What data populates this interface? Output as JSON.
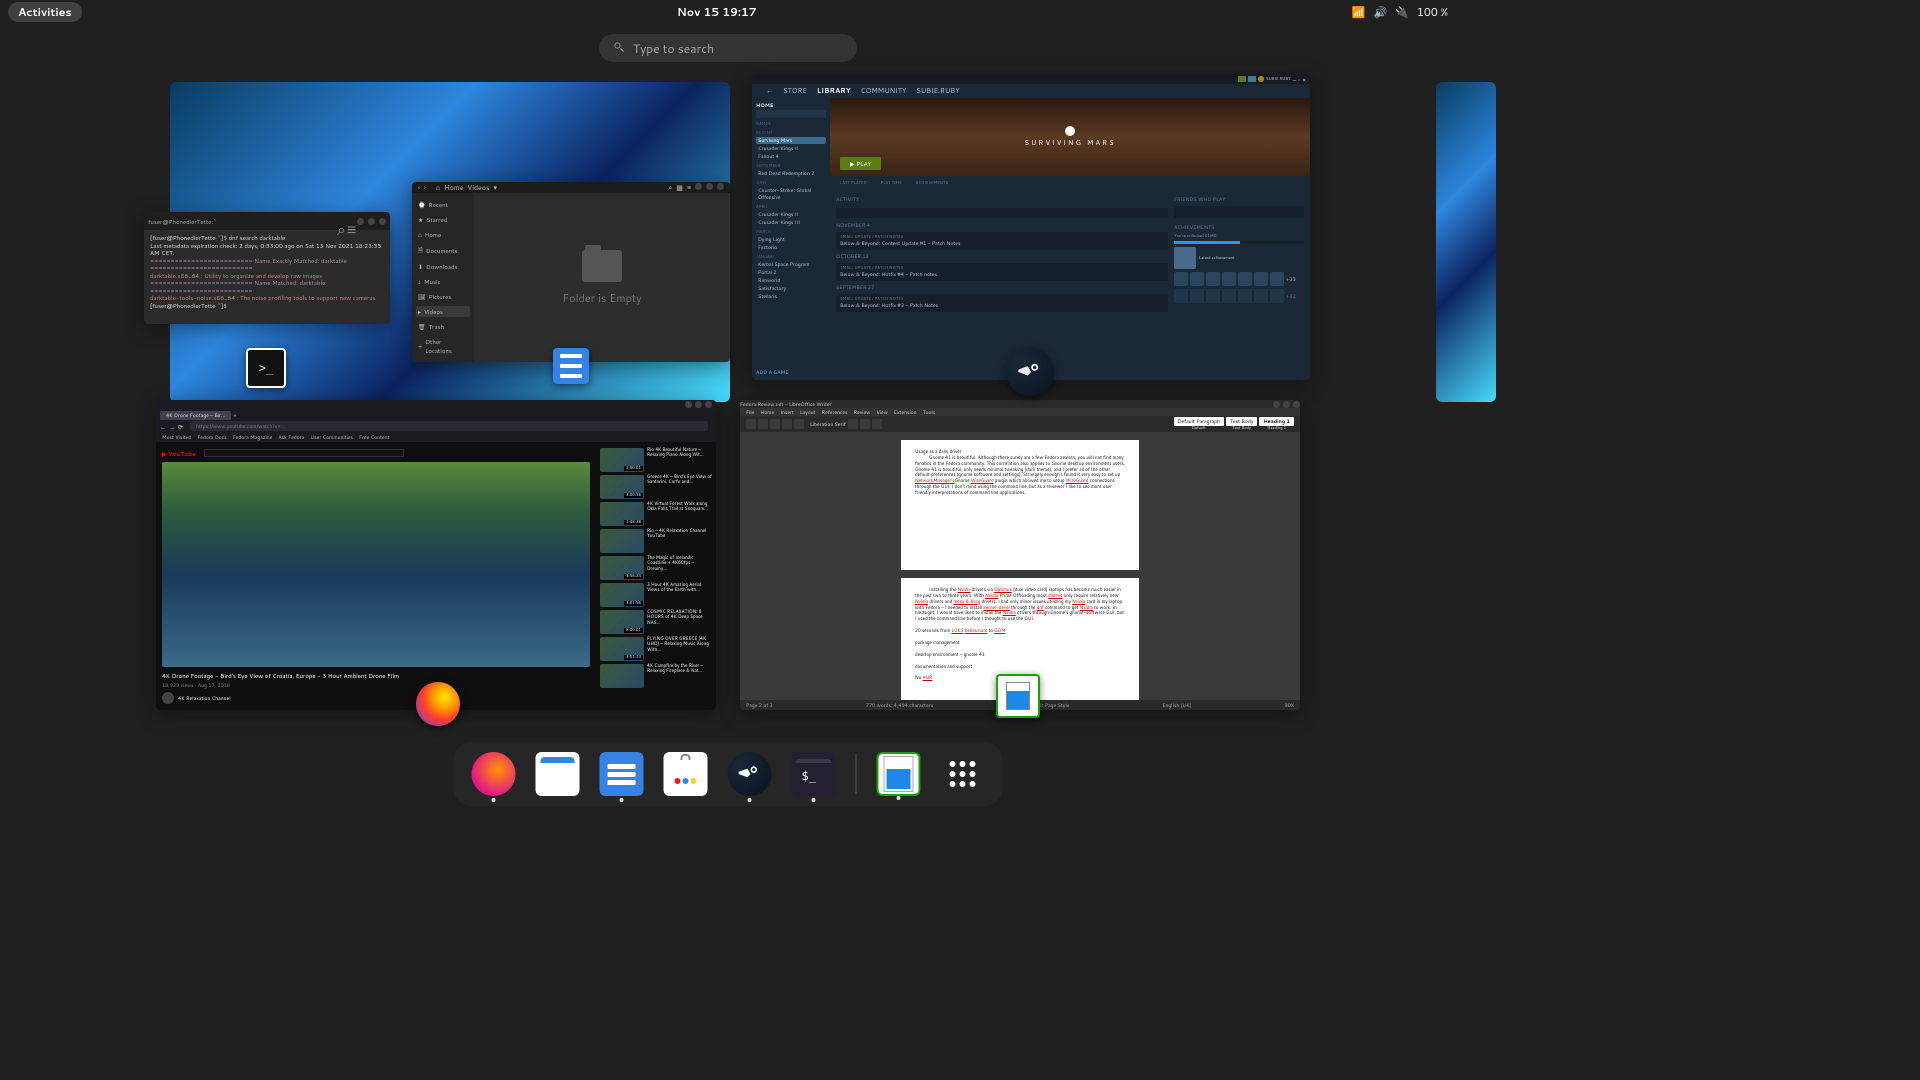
{
  "topbar": {
    "activities": "Activities",
    "clock": "Nov 15  19:17",
    "battery": "100 %"
  },
  "search": {
    "placeholder": "Type to search"
  },
  "terminal": {
    "user_host": "fuser@PhonedierTette:~",
    "lines": [
      "[fuser@PhonedierTette ~]$ dnf search darktable",
      "Last metadata expiration check: 2 days, 0:53:00 ago on Sat 13 Nov 2021 18:23:55 AM CET.",
      "========================= Name Exactly Matched: darktable =========================",
      "darktable.x86_64 : Utility to organize and develop raw images",
      "========================= Name Matched: darktable =========================",
      "darktable-tools-noise.x86_64 : The noise profiling tools to support new cameras",
      "[fuser@PhonedierTette ~]$ "
    ]
  },
  "nautilus": {
    "path": [
      "Home",
      "Videos"
    ],
    "sidebar": [
      "Recent",
      "Starred",
      "Home",
      "Documents",
      "Downloads",
      "Music",
      "Pictures",
      "Videos",
      "Trash",
      "Other Locations"
    ],
    "active": "Videos",
    "empty": "Folder is Empty"
  },
  "steam": {
    "nav": [
      "STORE",
      "LIBRARY",
      "COMMUNITY",
      "SUBIE.RUBY"
    ],
    "nav_active": "LIBRARY",
    "home": "HOME",
    "games_label": "GAMES",
    "side_headers": [
      "RECENT",
      "MARCH",
      "SEPTEMBER",
      "JUNE",
      "APRIL",
      "JANUARY"
    ],
    "games_recent": [
      "Surviving Mars",
      "Crusader Kings II",
      "Fallout 4"
    ],
    "games_other": [
      "Red Dead Redemption 2",
      "Counter-Strike: Global Offensive",
      "Crusader Kings II",
      "Crusader Kings III",
      "Dying Light",
      "Factorio",
      "Kerbal Space Program",
      "Portal 2",
      "Rimworld",
      "Satisfactory",
      "Stellaris"
    ],
    "current_game": "SURVIVING MARS",
    "play": "▶  PLAY",
    "stats": [
      "LAST PLAYED",
      "PLAY TIME",
      "ACHIEVEMENTS"
    ],
    "activity": "ACTIVITY",
    "feed_dates": [
      "NOVEMBER 4",
      "OCTOBER 13",
      "SEPTEMBER 27"
    ],
    "feed_items": [
      "Below & Beyond: Content Update #1 – Patch Notes",
      "Below & Beyond: Hotfix #4 – Patch notes",
      "Below & Beyond: Hotfix #3 – Patch Notes"
    ],
    "feed_sub": "SMALL UPDATE / PATCH NOTES",
    "friends": "FRIENDS WHO PLAY",
    "ach_hdr": "ACHIEVEMENTS",
    "ach_unlocked": "You've unlocked 41/80",
    "ach_latest": "Latest achievement",
    "ach_more1": "+33",
    "ach_more2": "+32",
    "add_game": "ADD A GAME"
  },
  "firefox": {
    "tab": "4K Drone Footage – Bir...",
    "url": "https://www.youtube.com/watch?v=...",
    "bookmarks": [
      "Most Visited",
      "Fedora Docs",
      "Fedora Magazine",
      "Ask Fedora",
      "User Communities",
      "Free Content"
    ],
    "video_title": "4K Drone Footage - Bird's Eye View of Croatia, Europe - 3 Hour Ambient Drone Film",
    "video_meta": "18,929 views · Aug 17, 2018",
    "channel": "4K Relaxation Channel",
    "suggestions": [
      {
        "t": "Rio 4K Beautiful Nature – Relaxing Piano Along Wit...",
        "d": "2:00:01"
      },
      {
        "t": "Greece 4K – Bird's Eye View of Santorini, Corfu and...",
        "d": "3:00:16"
      },
      {
        "t": "4K Virtual Forest Walk along Okla Falls Trail at Snoquam...",
        "d": "1:48:38"
      },
      {
        "t": "Rio – 4K Relaxation Channel YouTube",
        "d": ""
      },
      {
        "t": "The Magic of Icelandic Coastline + 4K60fps – Dreamy...",
        "d": "3:56:24"
      },
      {
        "t": "3 Hour 4K Amazing Aerial Views of the Earth with...",
        "d": "3:01:56"
      },
      {
        "t": "COSMIC RELAXATION: 8 HOURS of 4K Deep Space NAS...",
        "d": "8:00:01"
      },
      {
        "t": "FLYING OVER GREECE (4K UHD) – Relaxing Music Along With...",
        "d": "3:01:23"
      },
      {
        "t": "4K Campfire by the River – Relaxing Fireplace & Nat...",
        "d": ""
      }
    ]
  },
  "libreoffice": {
    "title": "Fedora Review.odt – LibreOffice Writer",
    "menu": [
      "File",
      "Home",
      "Insert",
      "Layout",
      "References",
      "Review",
      "View",
      "Extension",
      "Tools"
    ],
    "font": "Liberation Serif",
    "styles": [
      "Default Paragraph",
      "Text Body",
      "Heading 1"
    ],
    "style_sub": [
      "Default",
      "Text Body",
      "Heading 1"
    ],
    "status_left": "Page 2 of 3",
    "status_words": "770 words; 4,494 characters",
    "status_style": "Default Page Style",
    "status_lang": "English (UK)",
    "status_zoom": "90%",
    "para1": "Usage as a daily driver",
    "para2": "Gnome 41 is beautiful. Although there surely are a few Fedora zealots, you will not find many fanatics in the Fedora community. This correlation also applies to Gnome desktop environment users. Gnome 41 is beautiful, only needs minimal tweaking (dark theme), and I prefer all of the other default preferences (gnome software and settings). Strangely enough I found it very easy to set up",
    "para3": "NetworkManager's",
    "para4": "Gnome ",
    "para5": "WireGuard",
    "para6": " plugin which allowed me to setup ",
    "para7": "WireGuard",
    "para8": " connections through the GUI. I don't mind using the command line, but as a reviewer I like to see more user friendly interpretations of command line applications.",
    "p2a": "Installing the ",
    "p2b": "Nvidia",
    "p2c": " drivers via ",
    "p2d": "Optimus",
    "p2e": " (dual video card) laptops has become much easier in the past two to three years. With ",
    "p2f": "Nvidia",
    "p2g": " Prime Offloading most ",
    "p2h": "distros",
    "p2i": " only require relatively new ",
    "p2j": "Nvidia",
    "p2k": " drivers and ",
    "p2l": "mesa & Xorg",
    "p2m": " drivers. I had only minor issues utilizing my ",
    "p2n": "Nvidia",
    "p2o": " card in my laptop with Fedora – I needed to install ",
    "p2p": "kernel-devel",
    "p2q": " through the ",
    "p2r": "dnf",
    "p2s": " command to get ",
    "p2t": "Nvidia",
    "p2u": " to work. In hindsight, I would have liked to install the ",
    "p2v": "Nvidia",
    "p2w": " drivers through Gnome's gnome-software GUI, but I used the command line before I thought to use the GUI.",
    "p3a": "20 seconds from ",
    "p3b": "LUKS",
    "p3c": " ",
    "p3d": "helios.nom",
    "p3e": " to ",
    "p3f": "GDM",
    "p4": "package management",
    "p5": "desktop environment – gnome 41",
    "p6": "documentation and support",
    "p7": "No ",
    "p7b": "AUR"
  },
  "dock": {
    "items": [
      "firefox",
      "calendar",
      "files",
      "software",
      "steam",
      "terminal",
      "writer",
      "show-apps"
    ]
  }
}
